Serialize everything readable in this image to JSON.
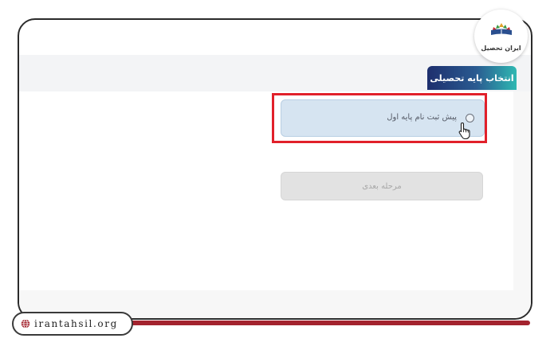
{
  "logo": {
    "text": "ایران تحصیل"
  },
  "tab": {
    "label": "انتخاب پایه تحصیلی"
  },
  "option": {
    "label": "پیش ثبت نام پایه اول"
  },
  "next_button": {
    "label": "مرحله بعدی"
  },
  "footer": {
    "site": "irantahsil.org"
  },
  "colors": {
    "highlight": "#e1202a",
    "accent_bar": "#a3232e",
    "tab_start": "#1e2f6e",
    "tab_end": "#2fb8b2"
  }
}
